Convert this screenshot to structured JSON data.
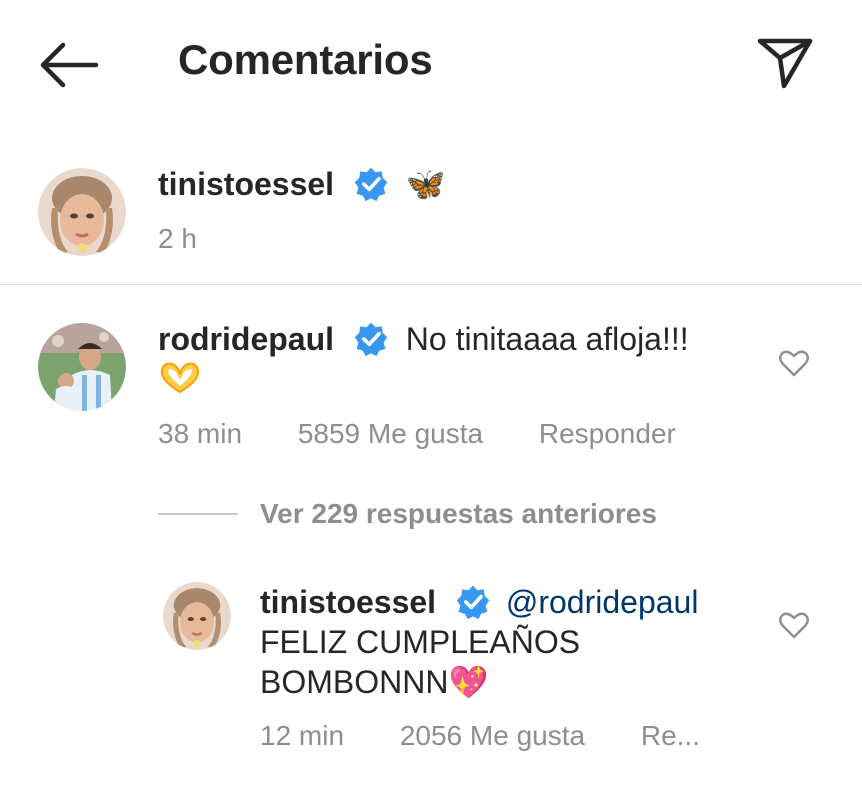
{
  "header": {
    "title": "Comentarios",
    "back_icon": "arrow-left-icon",
    "send_icon": "paper-plane-icon"
  },
  "caption": {
    "username": "tinistoessel",
    "verified": true,
    "text": "🦋",
    "time": "2 h"
  },
  "comment": {
    "username": "rodridepaul",
    "verified": true,
    "text_line1": "No tinitaaaa afloja!!!",
    "emoji_line2": "🫶",
    "time": "38 min",
    "likes": "5859 Me gusta",
    "reply_label": "Responder",
    "view_replies": "Ver 229 respuestas anteriores"
  },
  "reply": {
    "username": "tinistoessel",
    "verified": true,
    "mention": "@rodridepaul",
    "text": "FELIZ CUMPLEAÑOS BOMBONNN💖",
    "time": "12 min",
    "likes": "2056 Me gusta",
    "reply_label": "Re..."
  },
  "colors": {
    "verified_blue": "#3897f0",
    "meta_gray": "#8e8e8e",
    "mention_blue": "#00376b",
    "text_dark": "#262626"
  }
}
